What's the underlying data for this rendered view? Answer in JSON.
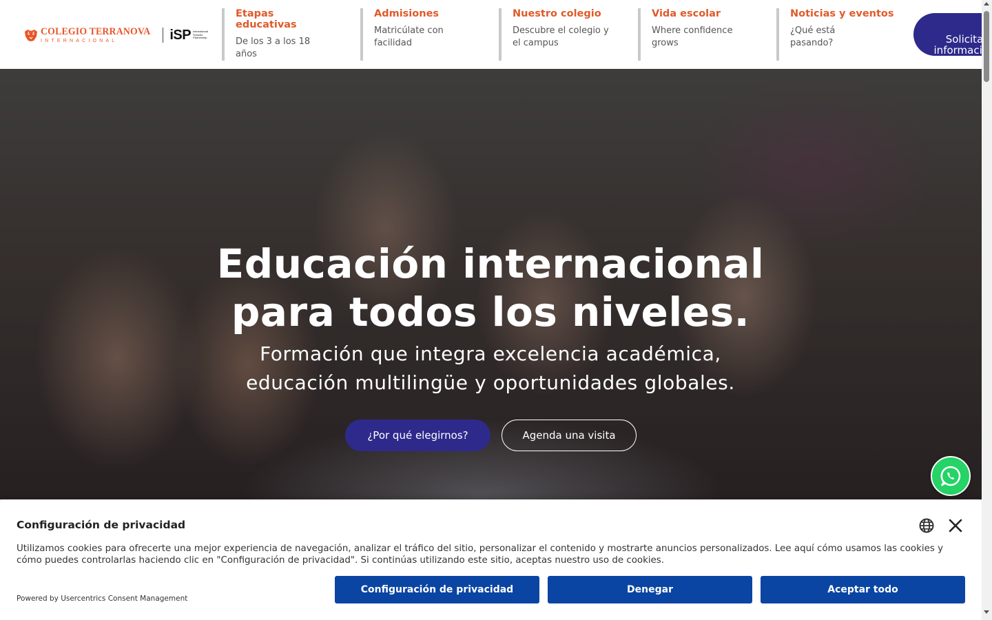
{
  "brand": {
    "name": "COLEGIO TERRANOVA",
    "sub": "INTERNACIONAL",
    "partner_mark": "iSP",
    "partner_desc": "International Schools Partnership",
    "accent_color": "#e05a2a",
    "primary_color": "#2e2a8c"
  },
  "nav": [
    {
      "title": "Etapas educativas",
      "subtitle": "De los 3 a los 18 años"
    },
    {
      "title": "Admisiones",
      "subtitle": "Matricúlate con facilidad"
    },
    {
      "title": "Nuestro colegio",
      "subtitle": "Descubre el colegio y el campus"
    },
    {
      "title": "Vida escolar",
      "subtitle": "Where confidence grows"
    },
    {
      "title": "Noticias y eventos",
      "subtitle": "¿Qué está pasando?"
    }
  ],
  "header_cta": "Solicita información",
  "hero": {
    "title_line1": "Educación internacional",
    "title_line2": "para todos los niveles.",
    "subtitle_line1": "Formación que integra excelencia académica,",
    "subtitle_line2": "educación multilingüe y oportunidades globales.",
    "primary_button": "¿Por qué elegirnos?",
    "secondary_button": "Agenda una visita"
  },
  "floating": {
    "icon": "whatsapp-icon",
    "color": "#25d366"
  },
  "cookie_banner": {
    "title": "Configuración de privacidad",
    "text": "Utilizamos cookies para ofrecerte una mejor experiencia de navegación, analizar el tráfico del sitio, personalizar el contenido y mostrarte anuncios personalizados. Lee aquí cómo usamos las cookies y cómo puedes controlarlas haciendo clic en \"Configuración de privacidad\". Si continúas utilizando este sitio, aceptas nuestro uso de cookies.",
    "powered_by": "Powered by Usercentrics Consent Management",
    "button_settings": "Configuración de privacidad",
    "button_deny": "Denegar",
    "button_accept": "Aceptar todo",
    "button_color": "#0a45a3"
  }
}
